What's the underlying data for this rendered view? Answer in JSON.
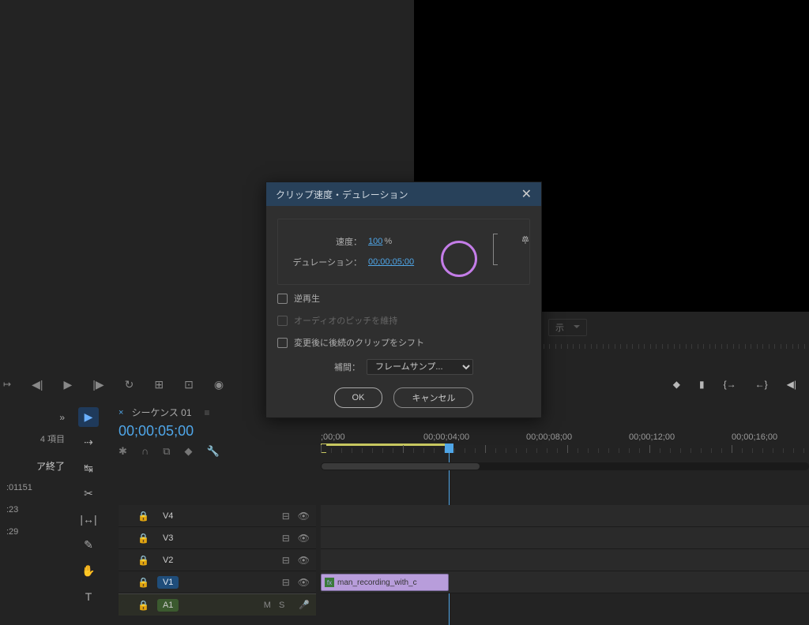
{
  "dialog": {
    "title": "クリップ速度・デュレーション",
    "speed_label": "速度：",
    "speed_value": "100",
    "speed_unit": "%",
    "duration_label": "デュレーション：",
    "duration_value": "00;00;05;00",
    "reverse_label": "逆再生",
    "maintain_pitch_label": "オーディオのピッチを維持",
    "ripple_label": "変更後に後続のクリップをシフト",
    "interp_label": "補間：",
    "interp_value": "フレームサンプ...",
    "ok": "OK",
    "cancel": "キャンセル"
  },
  "left": {
    "items_count": "4 項目",
    "end_label": "ア終了",
    "row1": ":01151",
    "row2": ":23",
    "row3": ":29"
  },
  "timeline": {
    "tab_name": "シーケンス 01",
    "playhead_tc": "00;00;05;00",
    "clip_name": "man_recording_with_c",
    "ruler": [
      ";00;00",
      "00;00;04;00",
      "00;00;08;00",
      "00;00;12;00",
      "00;00;16;00"
    ],
    "tracks_v": [
      "V4",
      "V3",
      "V2",
      "V1"
    ],
    "tracks_a": [
      "A1"
    ]
  },
  "program": {
    "dropdown": "示"
  }
}
